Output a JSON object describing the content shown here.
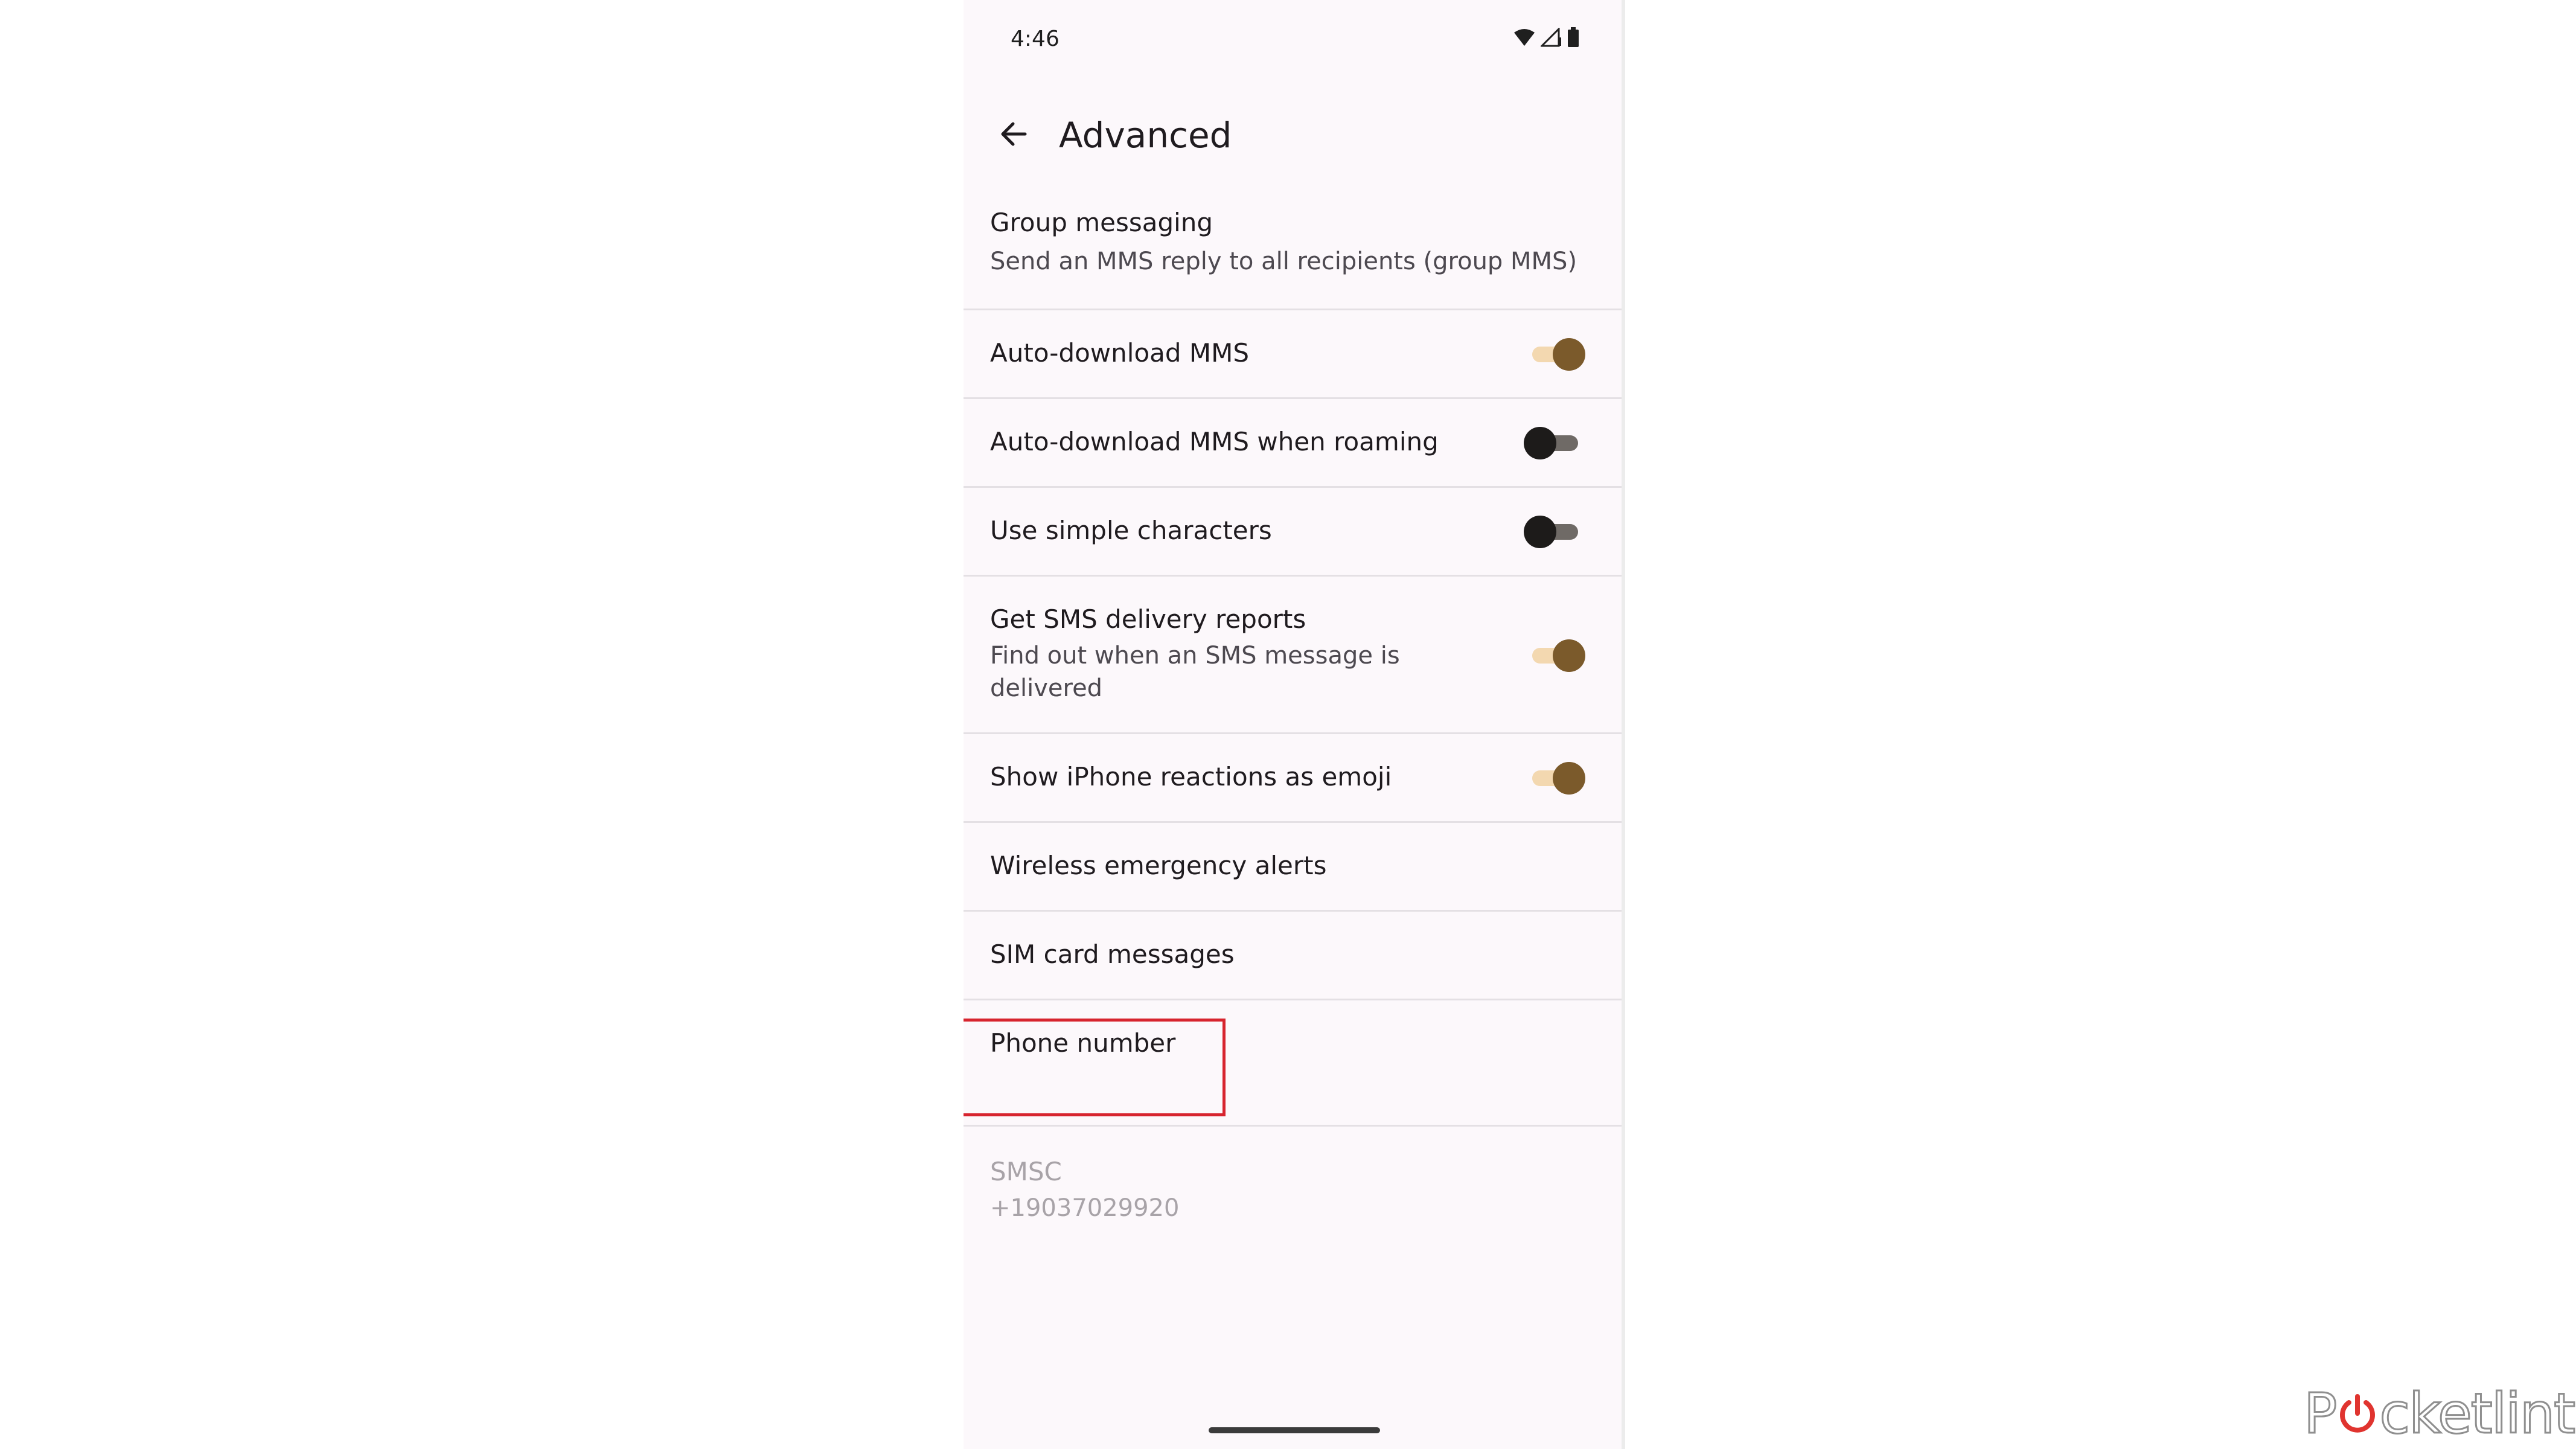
{
  "status_bar": {
    "time": "4:46",
    "icons": [
      "wifi-icon",
      "cell-signal-icon",
      "battery-icon"
    ]
  },
  "app_bar": {
    "back_icon": "arrow-back-icon",
    "title": "Advanced"
  },
  "settings": [
    {
      "id": "group-messaging",
      "title": "Group messaging",
      "subtitle": "Send an MMS reply to all recipients (group MMS)"
    },
    {
      "id": "auto-download-mms",
      "title": "Auto-download MMS",
      "toggle": true
    },
    {
      "id": "auto-download-mms-roaming",
      "title": "Auto-download MMS when roaming",
      "toggle": false
    },
    {
      "id": "use-simple-characters",
      "title": "Use simple characters",
      "toggle": false
    },
    {
      "id": "sms-delivery-reports",
      "title": "Get SMS delivery reports",
      "subtitle": "Find out when an SMS message is delivered",
      "toggle": true
    },
    {
      "id": "iphone-reactions",
      "title": "Show iPhone reactions as emoji",
      "toggle": true
    },
    {
      "id": "wireless-emergency-alerts",
      "title": "Wireless emergency alerts"
    },
    {
      "id": "sim-card-messages",
      "title": "SIM card messages"
    },
    {
      "id": "phone-number",
      "title": "Phone number",
      "subtitle": "",
      "highlighted": true
    },
    {
      "id": "smsc",
      "title": "SMSC",
      "subtitle": "+19037029920",
      "disabled": true
    }
  ],
  "colors": {
    "switch_on_thumb": "#7b5a2b",
    "switch_on_track": "#f3d8b0",
    "switch_off_thumb": "#1d1b1a",
    "switch_off_track": "#6f6a66",
    "highlight": "#d7242e",
    "background": "#fcf8fb"
  },
  "watermark": {
    "text_before": "P",
    "text_after": "cketlint",
    "logo_icon": "power-icon"
  }
}
